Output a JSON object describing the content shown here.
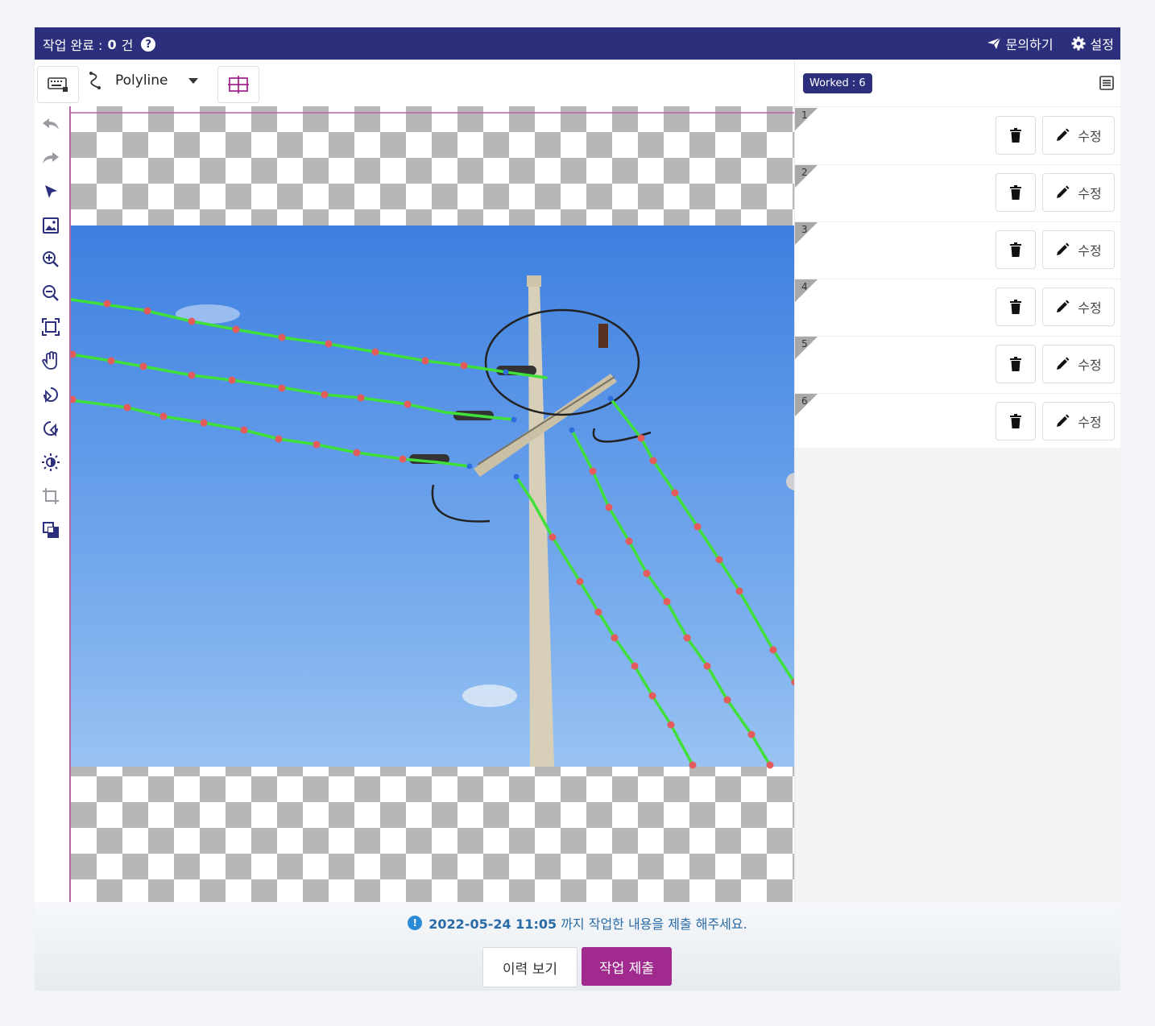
{
  "header": {
    "done_label": "작업 완료 : ",
    "done_count": "0",
    "done_unit": "건",
    "help": "?",
    "inquiry": "문의하기",
    "settings": "설정"
  },
  "toolbar": {
    "tool_label": "Polyline"
  },
  "panel": {
    "worked_badge": "Worked : 6",
    "rows": [
      {
        "num": "1",
        "edit": "수정"
      },
      {
        "num": "2",
        "edit": "수정"
      },
      {
        "num": "3",
        "edit": "수정"
      },
      {
        "num": "4",
        "edit": "수정"
      },
      {
        "num": "5",
        "edit": "수정"
      },
      {
        "num": "6",
        "edit": "수정"
      }
    ]
  },
  "footer": {
    "deadline": "2022-05-24 11:05",
    "deadline_suffix": " 까지 작업한 내용을 제출 해주세요.",
    "history_button": "이력 보기",
    "submit_button": "작업 제출"
  },
  "colors": {
    "header_bg": "#2c2f7c",
    "submit_bg": "#a02a8d",
    "line": "#3fe03a",
    "point": "#e35b5b"
  }
}
